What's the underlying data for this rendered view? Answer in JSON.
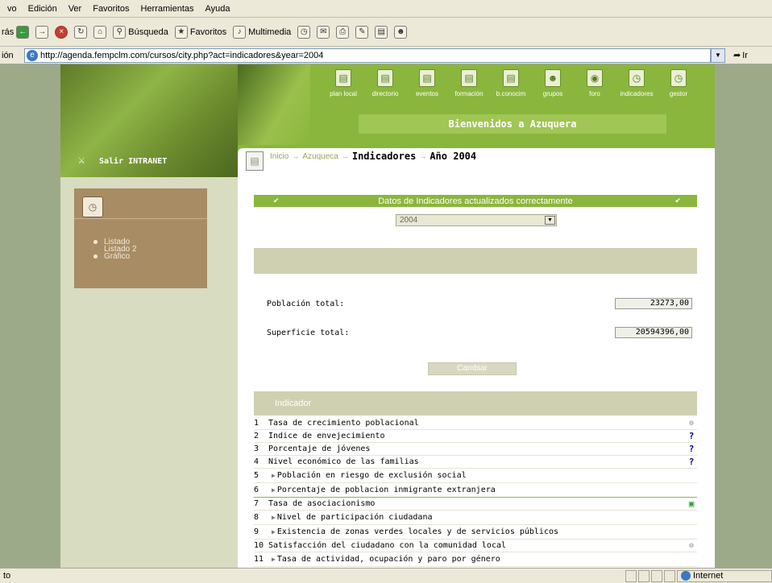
{
  "browser": {
    "menu": [
      "vo",
      "Edición",
      "Ver",
      "Favoritos",
      "Herramientas",
      "Ayuda"
    ],
    "toolbar": {
      "back": "rás",
      "search": "Búsqueda",
      "favorites": "Favoritos",
      "media": "Multimedia"
    },
    "address_label": "ión",
    "url": "http://agenda.fempclm.com/cursos/city.php?act=indicadores&year=2004",
    "go_label": "Ir",
    "status_text": "to",
    "zone": "Internet"
  },
  "nav": [
    {
      "label": "plan local",
      "icon": "plan-icon"
    },
    {
      "label": "directorio",
      "icon": "directory-icon"
    },
    {
      "label": "eventos",
      "icon": "events-icon"
    },
    {
      "label": "formación",
      "icon": "training-icon"
    },
    {
      "label": "b.conocim",
      "icon": "knowledge-icon"
    },
    {
      "label": "grupos",
      "icon": "groups-icon"
    },
    {
      "label": "foro",
      "icon": "forum-icon"
    },
    {
      "label": "indicadores",
      "icon": "indicators-icon"
    },
    {
      "label": "gestor",
      "icon": "manager-icon"
    }
  ],
  "welcome": "Bienvenidos a Azuquera",
  "salir": "Salir INTRANET",
  "left_menu": [
    "Listado",
    "Listado 2",
    "Gráfico"
  ],
  "breadcrumb": {
    "inicio": "Inicio",
    "azuqueca": "Azuqueca",
    "current": "Indicadores",
    "year": "Año 2004"
  },
  "status_msg": "Datos de Indicadores actualizados correctamente",
  "year_select": "2004",
  "fields": {
    "pob_label": "Población total:",
    "pob_value": "23273,00",
    "sup_label": "Superficie total:",
    "sup_value": "20594396,00",
    "button": "Cambiar"
  },
  "indicator_header": "Indicador",
  "indicators": [
    {
      "n": "1",
      "text": "Tasa de crecimiento poblacional",
      "sub": false,
      "status": "minus"
    },
    {
      "n": "2",
      "text": "Indice de envejecimiento",
      "sub": false,
      "status": "q"
    },
    {
      "n": "3",
      "text": "Porcentaje de jóvenes",
      "sub": false,
      "status": "q"
    },
    {
      "n": "4",
      "text": "Nivel económico de las familias",
      "sub": false,
      "status": "q"
    },
    {
      "n": "5",
      "text": "Población en riesgo de exclusión social",
      "sub": true,
      "status": ""
    },
    {
      "n": "6",
      "text": "Porcentaje de poblacion inmigrante extranjera",
      "sub": true,
      "status": ""
    },
    {
      "n": "7",
      "text": "Tasa de asociacionismo",
      "sub": false,
      "status": "sq"
    },
    {
      "n": "8",
      "text": "Nivel de participación ciudadana",
      "sub": true,
      "status": ""
    },
    {
      "n": "9",
      "text": "Existencia de zonas verdes locales y de servicios públicos",
      "sub": true,
      "status": ""
    },
    {
      "n": "10",
      "text": "Satisfacción del ciudadano con la comunidad local",
      "sub": false,
      "status": "minus"
    },
    {
      "n": "11",
      "text": "Tasa de actividad, ocupación y paro por género",
      "sub": true,
      "status": ""
    }
  ]
}
